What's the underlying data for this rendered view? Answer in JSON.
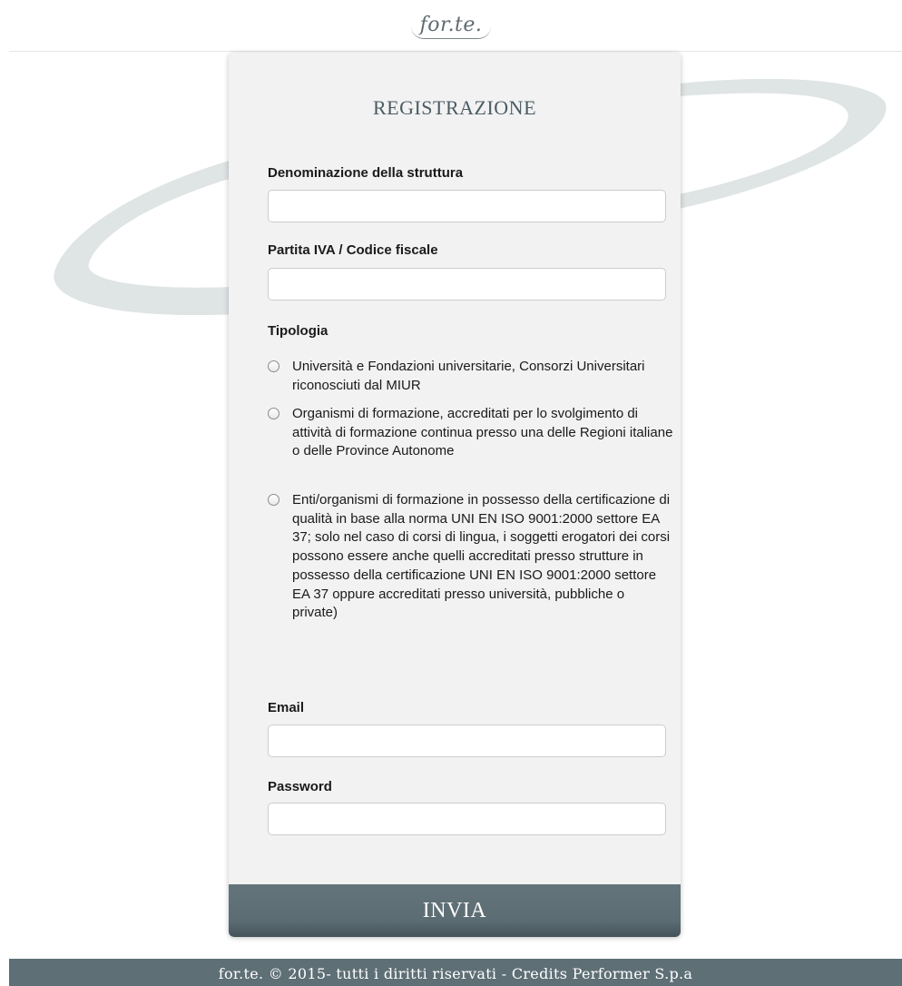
{
  "header": {
    "logo_text": "for.te."
  },
  "form": {
    "title": "REGISTRAZIONE",
    "fields": {
      "denominazione": {
        "label": "Denominazione della struttura",
        "value": "",
        "placeholder": ""
      },
      "partita_iva": {
        "label": "Partita IVA / Codice fiscale",
        "value": "",
        "placeholder": ""
      },
      "email": {
        "label": "Email",
        "value": "",
        "placeholder": ""
      },
      "password": {
        "label": "Password",
        "value": "",
        "placeholder": ""
      }
    },
    "tipologia": {
      "label": "Tipologia",
      "options": [
        {
          "text": "Università e Fondazioni universitarie, Consorzi Universitari riconosciuti dal MIUR",
          "selected": false
        },
        {
          "text": "Organismi di formazione, accreditati per lo svolgimento di attività di formazione continua presso una delle Regioni italiane o delle Province Autonome",
          "selected": false
        },
        {
          "text": "Enti/organismi di formazione in possesso della certificazione di qualità in base alla norma UNI EN ISO 9001:2000 settore EA 37; solo nel caso di corsi di lingua, i soggetti erogatori dei corsi possono essere anche quelli accreditati presso strutture in possesso della certificazione UNI EN ISO 9001:2000 settore EA 37 oppure accreditati presso università, pubbliche o private)",
          "selected": false
        }
      ]
    },
    "submit_label": "INVIA"
  },
  "footer": {
    "text": "for.te. © 2015- tutti i diritti riservati - Credits Performer S.p.a"
  },
  "colors": {
    "accent": "#5e6f76",
    "card_background": "#f2f2f2",
    "title_text": "#4b5c63",
    "swoosh": "#dfe4e5"
  }
}
